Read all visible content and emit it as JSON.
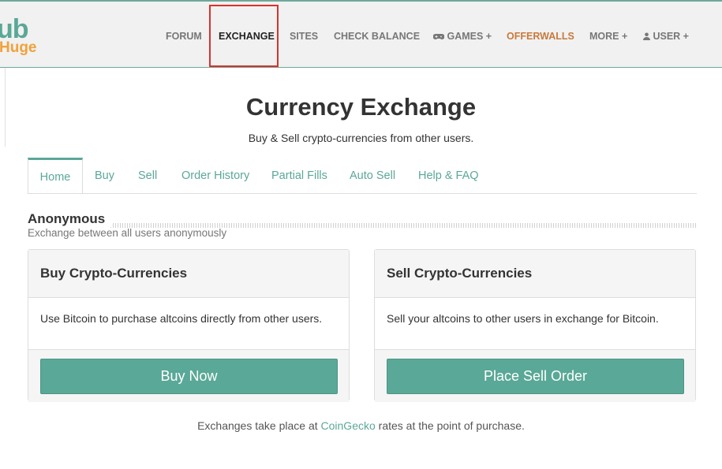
{
  "header": {
    "logo_top": "ub",
    "logo_bottom": "Huge",
    "nav": [
      {
        "label": "FORUM"
      },
      {
        "label": "EXCHANGE"
      },
      {
        "label": "SITES"
      },
      {
        "label": "CHECK BALANCE"
      },
      {
        "label": "GAMES +",
        "icon": "gamepad-icon"
      },
      {
        "label": "OFFERWALLS"
      },
      {
        "label": "MORE +"
      },
      {
        "label": "USER +",
        "icon": "user-icon"
      }
    ],
    "active_item": "EXCHANGE"
  },
  "page": {
    "title": "Currency Exchange",
    "subtitle": "Buy & Sell crypto-currencies from other users."
  },
  "tabs": [
    "Home",
    "Buy",
    "Sell",
    "Order History",
    "Partial Fills",
    "Auto Sell",
    "Help & FAQ"
  ],
  "section": {
    "title": "Anonymous",
    "subtitle": "Exchange between all users anonymously"
  },
  "cards": {
    "buy": {
      "title": "Buy Crypto-Currencies",
      "body": "Use Bitcoin to purchase altcoins directly from other users.",
      "button": "Buy Now"
    },
    "sell": {
      "title": "Sell Crypto-Currencies",
      "body": "Sell your altcoins to other users in exchange for Bitcoin.",
      "button": "Place Sell Order"
    }
  },
  "footnote": {
    "before": "Exchanges take place at ",
    "link": "CoinGecko",
    "after": " rates at the point of purchase."
  },
  "colors": {
    "accent": "#5aa897",
    "orange": "#c87a3c",
    "highlight_box": "#d9322c"
  }
}
